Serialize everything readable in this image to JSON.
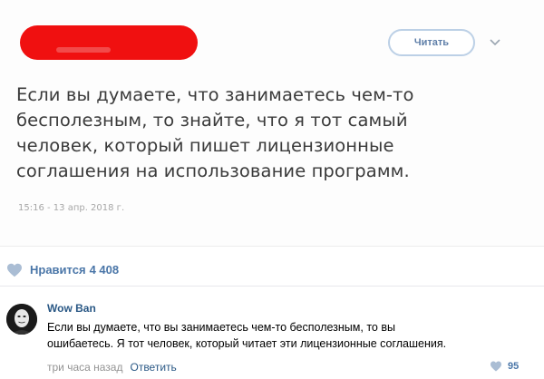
{
  "tweet": {
    "follow_label": "Читать",
    "text_lines": [
      "Если вы думаете, что занимаетесь чем-то",
      "бесполезным, то знайте, что я тот самый",
      "человек, который пишет лицензионные",
      "соглашения на использование программ."
    ],
    "timestamp": "15:16 - 13 апр. 2018 г."
  },
  "likes": {
    "label": "Нравится",
    "count": "4 408",
    "icon": "heart-icon",
    "color": "#4a76a8"
  },
  "comment": {
    "author": "Wow Ban",
    "text_lines": [
      "Если вы думаете, что вы занимаетесь чем-то бесполезным, то вы",
      "ошибаетесь. Я тот человек, который читает эти лицензионные соглашения."
    ],
    "time": "три часа назад",
    "reply_label": "Ответить",
    "like_count": "95"
  },
  "colors": {
    "link": "#2a5885",
    "accent": "#4a76a8",
    "redaction": "#f01010"
  }
}
